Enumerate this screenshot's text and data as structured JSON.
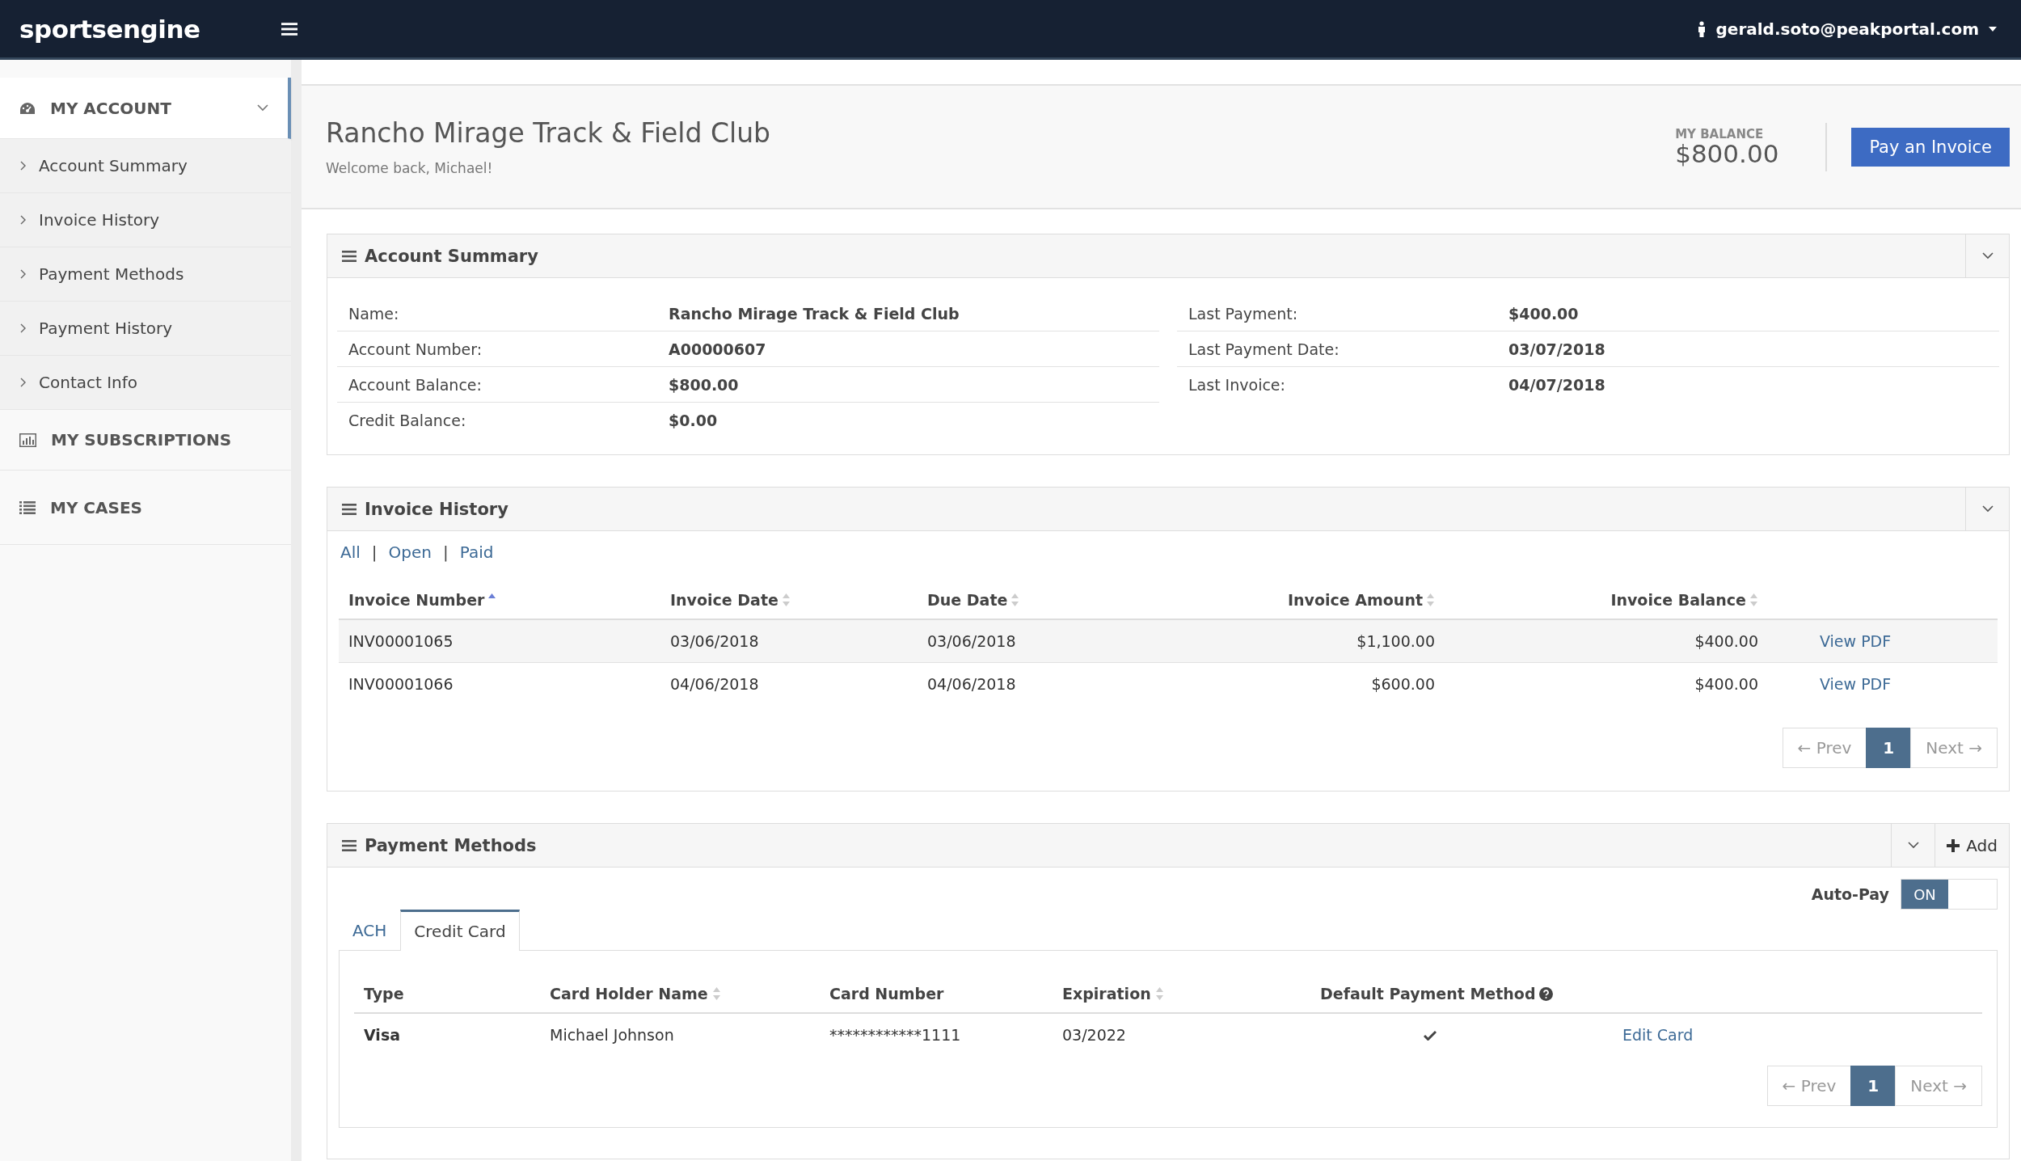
{
  "header": {
    "logo": "sportsengine",
    "user_email": "gerald.soto@peakportal.com"
  },
  "sidebar": {
    "sections": [
      {
        "label": "MY ACCOUNT",
        "expanded": true,
        "children": [
          {
            "label": "Account Summary"
          },
          {
            "label": "Invoice History"
          },
          {
            "label": "Payment Methods"
          },
          {
            "label": "Payment History"
          },
          {
            "label": "Contact Info"
          }
        ]
      },
      {
        "label": "MY SUBSCRIPTIONS",
        "expanded": false
      },
      {
        "label": "MY CASES",
        "expanded": false
      }
    ]
  },
  "page_header": {
    "title": "Rancho Mirage Track & Field Club",
    "subtitle": "Welcome back, Michael!",
    "balance_label": "MY BALANCE",
    "balance": "$800.00",
    "button": "Pay an Invoice"
  },
  "account_summary": {
    "title": "Account Summary",
    "left": [
      {
        "label": "Name:",
        "value": "Rancho Mirage Track & Field Club"
      },
      {
        "label": "Account Number:",
        "value": "A00000607"
      },
      {
        "label": "Account Balance:",
        "value": "$800.00"
      },
      {
        "label": "Credit Balance:",
        "value": "$0.00"
      }
    ],
    "right": [
      {
        "label": "Last Payment:",
        "value": "$400.00"
      },
      {
        "label": "Last Payment Date:",
        "value": "03/07/2018"
      },
      {
        "label": "Last Invoice:",
        "value": "04/07/2018"
      }
    ]
  },
  "invoice_history": {
    "title": "Invoice History",
    "filters": [
      "All",
      "Open",
      "Paid"
    ],
    "filter_separator": "|",
    "columns": [
      {
        "label": "Invoice Number",
        "sortable": true,
        "sorted": true
      },
      {
        "label": "Invoice Date",
        "sortable": true,
        "sorted": false
      },
      {
        "label": "Due Date",
        "sortable": true,
        "sorted": false
      },
      {
        "label": "Invoice Amount",
        "sortable": true,
        "sorted": false
      },
      {
        "label": "Invoice Balance",
        "sortable": true,
        "sorted": false
      }
    ],
    "rows": [
      {
        "number": "INV00001065",
        "invoice_date": "03/06/2018",
        "due_date": "03/06/2018",
        "amount": "$1,100.00",
        "balance": "$400.00",
        "link": "View PDF"
      },
      {
        "number": "INV00001066",
        "invoice_date": "04/06/2018",
        "due_date": "04/06/2018",
        "amount": "$600.00",
        "balance": "$400.00",
        "link": "View PDF"
      }
    ],
    "pagination": {
      "prev": "← Prev",
      "prev_disabled": true,
      "pages": [
        {
          "label": "1",
          "selected": true
        }
      ],
      "next": "Next →",
      "next_disabled": true
    }
  },
  "payment_methods": {
    "title": "Payment Methods",
    "add_button": "Add",
    "autopay": {
      "label": "Auto-Pay",
      "on": true,
      "on_label": "ON"
    },
    "tabs": [
      {
        "label": "ACH",
        "selected": false
      },
      {
        "label": "Credit Card",
        "selected": true
      }
    ],
    "columns": [
      {
        "label": "Type"
      },
      {
        "label": "Card Holder Name",
        "sortable": true
      },
      {
        "label": "Card Number"
      },
      {
        "label": "Expiration",
        "sortable": true
      },
      {
        "label": "Default Payment Method",
        "help": true
      }
    ],
    "rows": [
      {
        "type": "Visa",
        "holder": "Michael Johnson",
        "number": "************1111",
        "expiration": "03/2022",
        "default": true,
        "action": "Edit Card"
      }
    ],
    "pagination": {
      "prev": "← Prev",
      "prev_disabled": true,
      "pages": [
        {
          "label": "1",
          "selected": true
        }
      ],
      "next": "Next →",
      "next_disabled": true
    }
  }
}
